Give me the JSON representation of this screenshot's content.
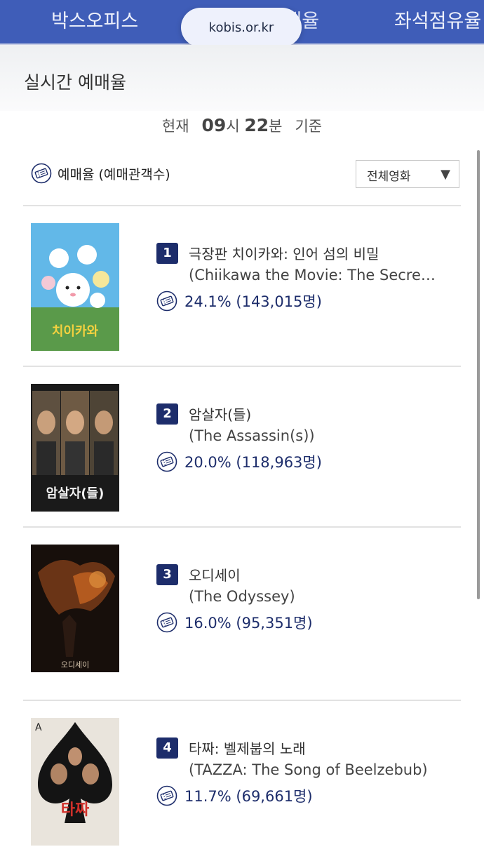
{
  "browser": {
    "url": "kobis.or.kr"
  },
  "nav_tabs": [
    {
      "label": "박스오피스"
    },
    {
      "label": "실시간예매율"
    },
    {
      "label": "좌석점유율"
    }
  ],
  "section": {
    "title": "실시간 예매율"
  },
  "time": {
    "prefix": "현재",
    "hour": "09",
    "hour_unit": "시",
    "minute": "22",
    "minute_unit": "분",
    "suffix": "기준"
  },
  "legend": {
    "label": "예매율 (예매관객수)",
    "icon": "ticket-icon"
  },
  "filter": {
    "selected": "전체영화",
    "arrow": "▼"
  },
  "movies": [
    {
      "rank": "1",
      "title_ko": "극장판 치이카와: 인어 섬의 비밀",
      "title_en": "(Chiikawa the Movie: The Secre…",
      "rate": "24.1% (143,015명)"
    },
    {
      "rank": "2",
      "title_ko": "암살자(들)",
      "title_en": "(The Assassin(s))",
      "rate": "20.0% (118,963명)"
    },
    {
      "rank": "3",
      "title_ko": "오디세이",
      "title_en": "(The Odyssey)",
      "rate": "16.0% (95,351명)"
    },
    {
      "rank": "4",
      "title_ko": "타짜: 벨제붑의 노래",
      "title_en": "(TAZZA: The Song of Beelzebub)",
      "rate": "11.7% (69,661명)"
    }
  ],
  "posters": [
    {
      "caption": "치이카와"
    },
    {
      "caption": "암살자(들)"
    },
    {
      "caption": "오디세이"
    },
    {
      "caption": "타짜"
    }
  ],
  "colors": {
    "nav": "#3f5db8",
    "rank_badge": "#1d2d6b",
    "rate_text": "#1d2d6b"
  }
}
